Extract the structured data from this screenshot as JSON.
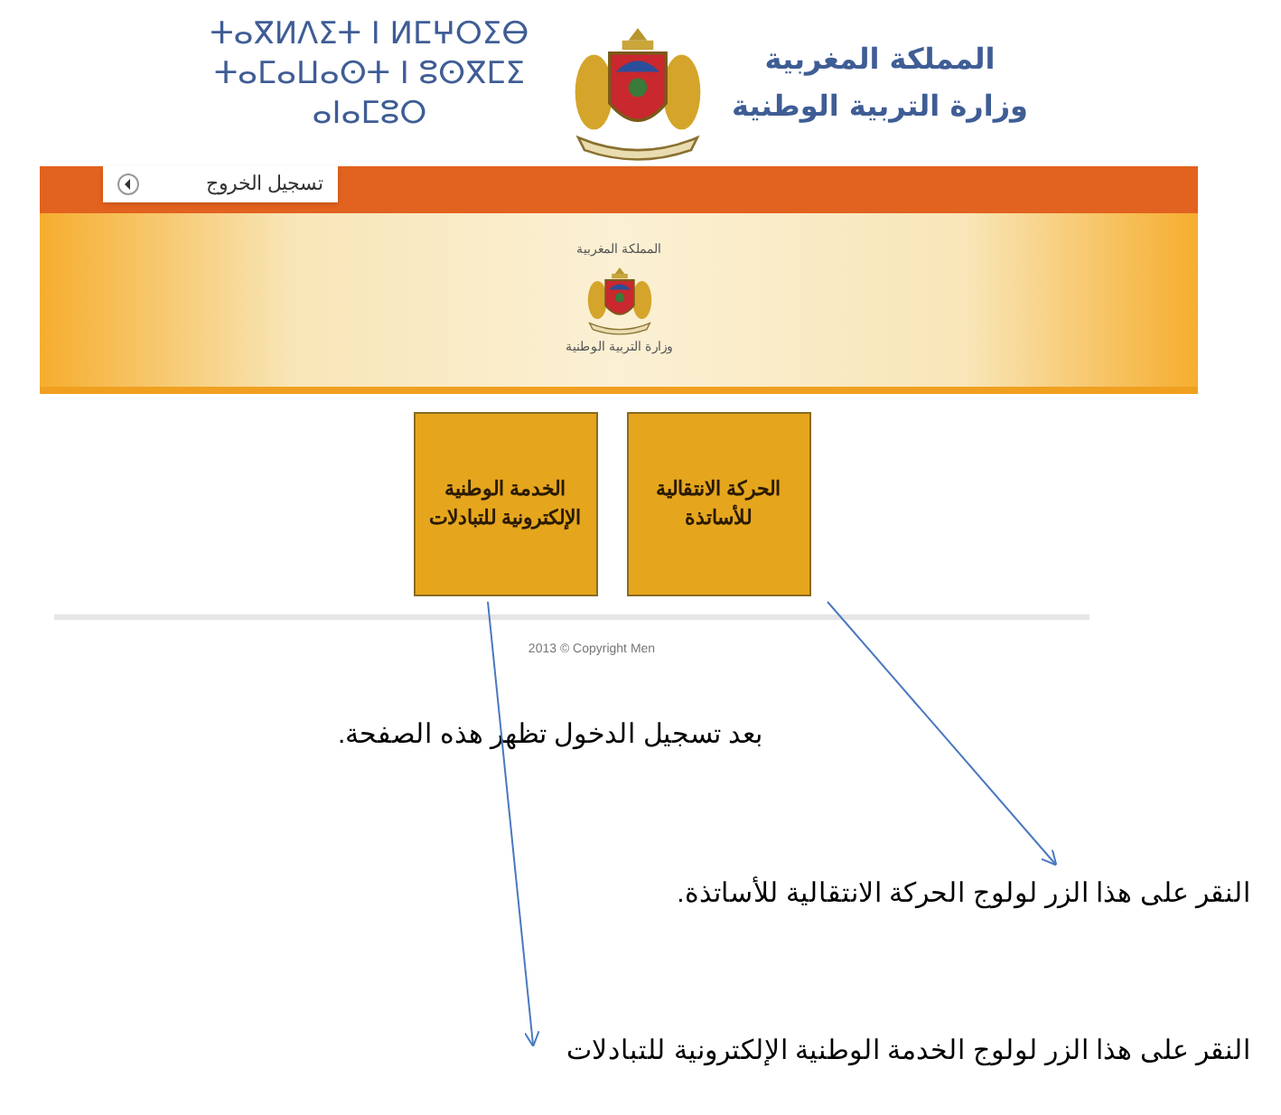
{
  "header": {
    "tifinagh_lines": [
      "ⵜⴰⴳⵍⴷⵉⵜ ⵏ ⵍⵎⵖⵔⵉⴱ",
      "ⵜⴰⵎⴰⵡⴰⵙⵜ ⵏ ⵓⵙⴳⵎⵉ",
      "ⴰⵏⴰⵎⵓⵔ"
    ],
    "arabic_lines": [
      "المملكة المغربية",
      "وزارة التربية الوطنية"
    ]
  },
  "embedded_page": {
    "logout_button": "تسجيل الخروج",
    "banner_top": "المملكة المغربية",
    "banner_bottom": "وزارة التربية الوطنية",
    "tiles": [
      "الحركة الانتقالية للأساتذة",
      "الخدمة الوطنية الإلكترونية للتبادلات"
    ],
    "footer": "2013 © Copyright Men"
  },
  "annotations": [
    "بعد تسجيل الدخول تظهر هذه الصفحة.",
    "النقر على هذا الزر لولوج الحركة الانتقالية للأساتذة.",
    "النقر على هذا الزر لولوج الخدمة الوطنية الإلكترونية للتبادلات"
  ]
}
